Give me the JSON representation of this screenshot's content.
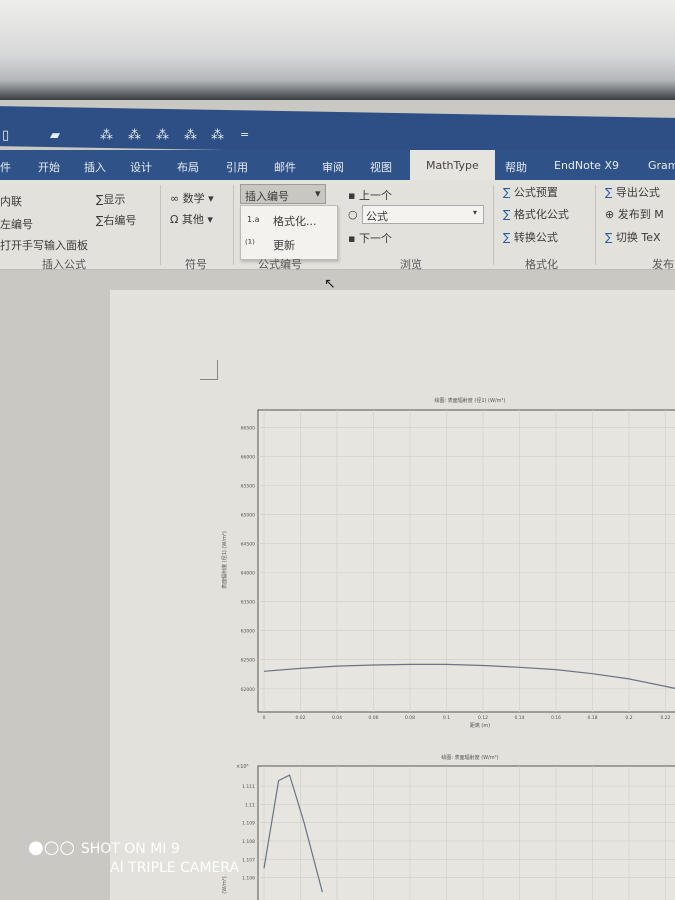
{
  "quick_access": {
    "icons": [
      "save-icon",
      "undo-icon",
      "open-icon",
      "redo-icon",
      "org-chart-icon",
      "org-chart-icon",
      "org-chart-icon",
      "org-chart-icon",
      "org-chart-icon"
    ],
    "more": "="
  },
  "tabs": [
    "件",
    "开始",
    "插入",
    "设计",
    "布局",
    "引用",
    "邮件",
    "审阅",
    "视图",
    "MathType",
    "帮助",
    "EndNote X9",
    "Gram"
  ],
  "ribbon": {
    "insert_formula": {
      "items": [
        "内联",
        "左编号",
        "打开手写输入面板",
        "显示",
        "右编号"
      ],
      "label": "插入公式"
    },
    "symbols": {
      "items": [
        "数学",
        "其他"
      ],
      "label": "符号"
    },
    "numbering": {
      "split_button": "插入编号",
      "menu": [
        "格式化...",
        "更新"
      ],
      "menu_icons": [
        "1.a",
        "⁽¹⁾"
      ],
      "label": "公式编号"
    },
    "browse": {
      "prev": "上一个",
      "combo": "公式",
      "next": "下一个",
      "label": "浏览"
    },
    "format": {
      "items": [
        "公式预置",
        "格式化公式",
        "转换公式"
      ],
      "label": "格式化"
    },
    "publish": {
      "items": [
        "导出公式",
        "发布到 M",
        "切换 TeX"
      ],
      "label": "发布"
    }
  },
  "watermark": {
    "line1": "SHOT ON MI 9",
    "line2": "AI TRIPLE CAMERA"
  },
  "chart_data": [
    {
      "type": "line",
      "title": "绘图: 表面辐射度 (径1) (W/m²)",
      "xlabel": "距离 (m)",
      "ylabel": "表面辐射度 (径1) (W/m²)",
      "xticks": [
        "0",
        "0.02",
        "0.04",
        "0.06",
        "0.08",
        "0.1",
        "0.12",
        "0.14",
        "0.16",
        "0.18",
        "0.2",
        "0.22"
      ],
      "yticks": [
        "66500",
        "66000",
        "65500",
        "65000",
        "64500",
        "64000",
        "63500",
        "63000",
        "62500",
        "62000"
      ],
      "xlim": [
        0,
        0.23
      ],
      "ylim": [
        61600,
        66800
      ],
      "grid": true,
      "x": [
        0,
        0.02,
        0.04,
        0.06,
        0.08,
        0.1,
        0.12,
        0.14,
        0.16,
        0.18,
        0.2,
        0.22,
        0.228
      ],
      "y": [
        62300,
        62350,
        62390,
        62410,
        62420,
        62420,
        62400,
        62370,
        62330,
        62260,
        62170,
        62040,
        61990
      ]
    },
    {
      "type": "line",
      "title": "绘图: 表面辐射度 (W/m²)",
      "multiplier": "×10⁵",
      "ylabel": "(W/m²)",
      "yticks": [
        "1.111",
        "1.11",
        "1.109",
        "1.108",
        "1.107",
        "1.106"
      ],
      "xlim": [
        0,
        0.23
      ],
      "ylim": [
        1.1045,
        1.1121
      ],
      "grid": true,
      "x": [
        0,
        0.008,
        0.014,
        0.022,
        0.032
      ],
      "y": [
        1.1065,
        1.1113,
        1.1116,
        1.109,
        1.1052
      ]
    }
  ]
}
